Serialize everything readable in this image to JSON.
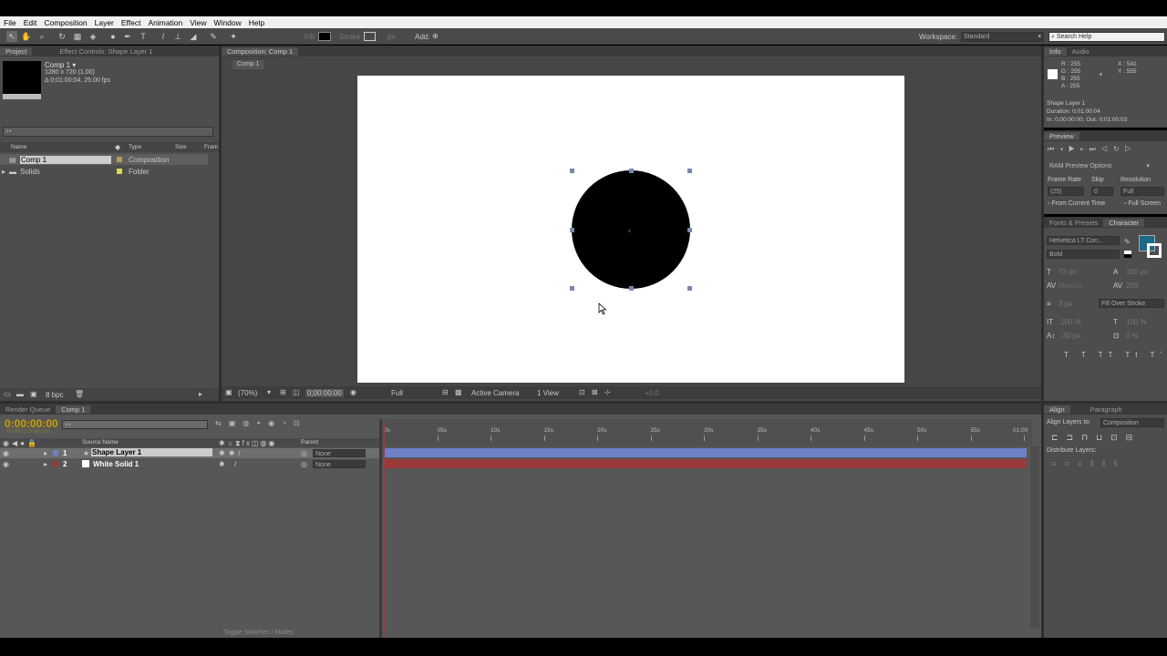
{
  "menu": [
    "File",
    "Edit",
    "Composition",
    "Layer",
    "Effect",
    "Animation",
    "View",
    "Window",
    "Help"
  ],
  "toolbar": {
    "fill": "Fill",
    "stroke": "Stroke",
    "px": "px",
    "add": "Add:",
    "workspace_label": "Workspace:",
    "workspace_value": "Standard",
    "search_placeholder": "Search Help"
  },
  "project": {
    "tab": "Project",
    "effect_tab": "Effect Controls: Shape Layer 1",
    "comp_name": "Comp 1 ▾",
    "comp_size": "1280 x 720 (1.00)",
    "comp_dur": "Δ 0;01:00:04, 25.00 fps",
    "col_name": "Name",
    "col_type": "Type",
    "col_size": "Size",
    "col_frame": "Fram",
    "items": [
      {
        "name": "Comp 1",
        "type": "Composition"
      },
      {
        "name": "Solids",
        "type": "Folder"
      }
    ],
    "bpc": "8 bpc"
  },
  "comp": {
    "tab": "Composition: Comp 1",
    "breadcrumb": "Comp 1",
    "zoom": "(70%)",
    "time": "0;00:00:00",
    "res": "Full",
    "camera": "Active Camera",
    "view": "1 View",
    "exposure": "+0.0"
  },
  "info": {
    "tab": "Info",
    "audio_tab": "Audio",
    "r": "R : 255",
    "g": "G : 255",
    "b": "B : 255",
    "a": "A : 255",
    "x": "X : 541",
    "y": "Y : 555",
    "layer": "Shape Layer 1",
    "duration": "Duration: 0;01:00:04",
    "inout": "In: 0;00:00:00, Out: 0;01:00:03"
  },
  "preview": {
    "tab": "Preview",
    "ram": "RAM Preview Options",
    "frame_rate": "Frame Rate",
    "skip": "Skip",
    "resolution": "Resolution",
    "fr_val": "(25)",
    "skip_val": "0",
    "res_val": "Full",
    "from_current": "From Current Time",
    "full_screen": "Full Screen"
  },
  "character": {
    "fonts_tab": "Fonts & Presets",
    "char_tab": "Character",
    "font": "Helvetica LT Con...",
    "style": "Bold",
    "size": "73 px",
    "leading": "100 px",
    "kerning": "Metrics",
    "tracking": "259",
    "stroke_w": "3 px",
    "stroke_mode": "Fill Over Stroke",
    "v_scale": "100 %",
    "h_scale": "100 %",
    "baseline": "-30 px",
    "tsume": "0 %"
  },
  "timeline": {
    "render_tab": "Render Queue",
    "comp_tab": "Comp 1",
    "timecode": "0:00:00:00",
    "fps": "00000 (25.00 fps)",
    "col_source": "Source Name",
    "col_parent": "Parent",
    "ticks": [
      "0s",
      "05s",
      "10s",
      "15s",
      "20s",
      "25s",
      "30s",
      "35s",
      "40s",
      "45s",
      "50s",
      "55s",
      "01:00"
    ],
    "layers": [
      {
        "num": "1",
        "name": "Shape Layer 1",
        "parent": "None"
      },
      {
        "num": "2",
        "name": "White Solid 1",
        "parent": "None"
      }
    ],
    "toggle": "Toggle Switches / Modes"
  },
  "align": {
    "tab": "Align",
    "para_tab": "Paragraph",
    "align_to": "Align Layers to:",
    "align_to_val": "Composition",
    "distribute": "Distribute Layers:"
  },
  "colors": {
    "layer1": "#7080c8",
    "layer2": "#9a3a3a",
    "accent": "#1a6a8a",
    "timecode": "#c8a000"
  }
}
